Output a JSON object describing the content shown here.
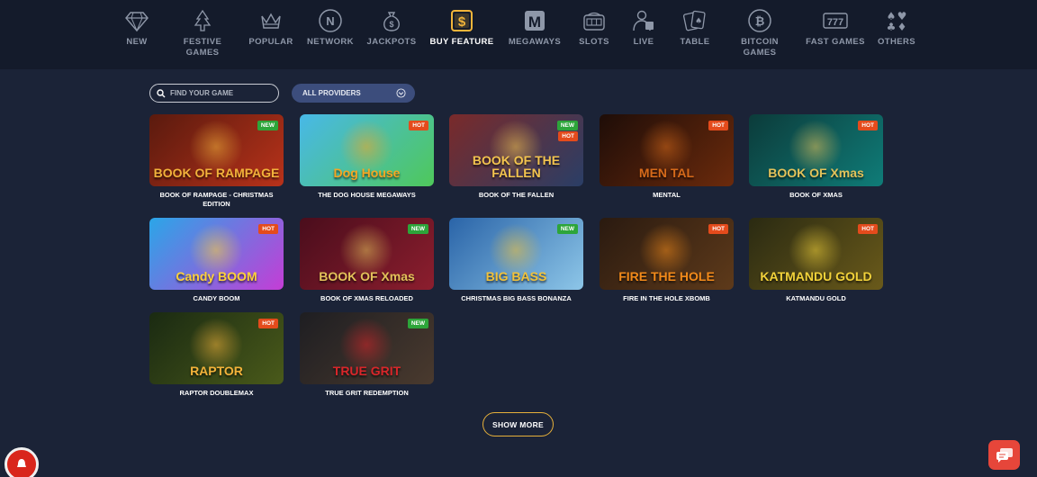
{
  "categories": [
    {
      "label": "NEW",
      "icon": "diamond-icon"
    },
    {
      "label": "FESTIVE\nGAMES",
      "icon": "tree-icon"
    },
    {
      "label": "POPULAR",
      "icon": "crown-icon"
    },
    {
      "label": "NETWORK",
      "icon": "network-icon"
    },
    {
      "label": "JACKPOTS",
      "icon": "money-bag-icon"
    },
    {
      "label": "BUY FEATURE",
      "icon": "dollar-square-icon",
      "active": true
    },
    {
      "label": "MEGAWAYS",
      "icon": "megaways-icon"
    },
    {
      "label": "SLOTS",
      "icon": "slot-machine-icon"
    },
    {
      "label": "LIVE",
      "icon": "dealer-icon"
    },
    {
      "label": "TABLE",
      "icon": "cards-icon"
    },
    {
      "label": "BITCOIN\nGAMES",
      "icon": "bitcoin-icon"
    },
    {
      "label": "FAST GAMES",
      "icon": "777-icon"
    },
    {
      "label": "OTHERS",
      "icon": "suits-icon"
    }
  ],
  "search": {
    "placeholder": "FIND YOUR GAME"
  },
  "provider": {
    "selected": "ALL PROVIDERS"
  },
  "games": [
    {
      "name": "BOOK OF RAMPAGE - CHRISTMAS EDITION",
      "badges": [
        "NEW"
      ],
      "art": "BOOK OF RAMPAGE",
      "c1": "#5a1a0e",
      "c2": "#b8321a",
      "accent": "#f2b23b"
    },
    {
      "name": "THE DOG HOUSE MEGAWAYS",
      "badges": [
        "HOT"
      ],
      "art": "Dog House",
      "c1": "#48b8e8",
      "c2": "#4fc85a",
      "accent": "#f5a623"
    },
    {
      "name": "BOOK OF THE FALLEN",
      "badges": [
        "NEW",
        "HOT"
      ],
      "art": "BOOK OF THE FALLEN",
      "c1": "#7a2a2a",
      "c2": "#2a3e66",
      "accent": "#f3c44f"
    },
    {
      "name": "MENTAL",
      "badges": [
        "HOT"
      ],
      "art": "MEN TAL",
      "c1": "#1e0d08",
      "c2": "#6b2a0c",
      "accent": "#d66a1a"
    },
    {
      "name": "BOOK OF XMAS",
      "badges": [
        "HOT"
      ],
      "art": "BOOK OF Xmas",
      "c1": "#0c3b3a",
      "c2": "#0f7c78",
      "accent": "#e3c25a"
    },
    {
      "name": "CANDY BOOM",
      "badges": [
        "HOT"
      ],
      "art": "Candy BOOM",
      "c1": "#2aa6e8",
      "c2": "#c43dd6",
      "accent": "#ffd23a"
    },
    {
      "name": "BOOK OF XMAS RELOADED",
      "badges": [
        "NEW"
      ],
      "art": "BOOK OF Xmas",
      "c1": "#4a0d1c",
      "c2": "#8c1e2e",
      "accent": "#e3c25a"
    },
    {
      "name": "CHRISTMAS BIG BASS BONANZA",
      "badges": [
        "NEW"
      ],
      "art": "BIG BASS",
      "c1": "#2a64a8",
      "c2": "#8dc6e8",
      "accent": "#f2c23a"
    },
    {
      "name": "FIRE IN THE HOLE XBOMB",
      "badges": [
        "HOT"
      ],
      "art": "FIRE THE HOLE",
      "c1": "#2a1a10",
      "c2": "#5e3a1a",
      "accent": "#f28a1a"
    },
    {
      "name": "KATMANDU GOLD",
      "badges": [
        "HOT"
      ],
      "art": "KATMANDU GOLD",
      "c1": "#2a2a12",
      "c2": "#6a5a1a",
      "accent": "#f2d23a"
    },
    {
      "name": "RAPTOR DOUBLEMAX",
      "badges": [
        "HOT"
      ],
      "art": "RAPTOR",
      "c1": "#1a2a12",
      "c2": "#4a5a1a",
      "accent": "#f2b23a"
    },
    {
      "name": "TRUE GRIT REDEMPTION",
      "badges": [
        "NEW"
      ],
      "art": "TRUE GRIT",
      "c1": "#1e1e22",
      "c2": "#4a3a2e",
      "accent": "#d8262a"
    }
  ],
  "show_more_label": "SHOW MORE"
}
